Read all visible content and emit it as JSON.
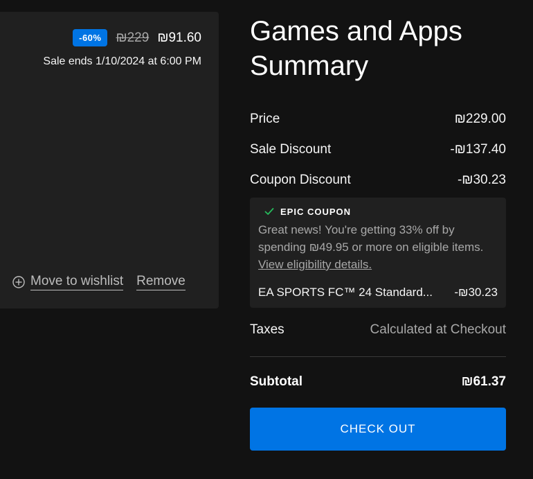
{
  "item": {
    "discount_badge": "-60%",
    "original_price": "₪229",
    "sale_price": "₪91.60",
    "sale_ends": "Sale ends 1/10/2024 at 6:00 PM",
    "move_to_wishlist": "Move to wishlist",
    "remove": "Remove"
  },
  "summary": {
    "title": "Games and Apps Summary",
    "price_label": "Price",
    "price_value": "₪229.00",
    "sale_discount_label": "Sale Discount",
    "sale_discount_value": "-₪137.40",
    "coupon_discount_label": "Coupon Discount",
    "coupon_discount_value": "-₪30.23",
    "coupon": {
      "heading": "EPIC COUPON",
      "text": "Great news! You're getting 33% off by spending ₪49.95 or more on eligible items. ",
      "link": "View eligibility details.",
      "item_name": "EA SPORTS FC™ 24 Standard...",
      "item_value": "-₪30.23"
    },
    "taxes_label": "Taxes",
    "taxes_value": "Calculated at Checkout",
    "subtotal_label": "Subtotal",
    "subtotal_value": "₪61.37",
    "checkout_label": "CHECK OUT"
  },
  "colors": {
    "background": "#121212",
    "card": "#202020",
    "accent": "#0074e4",
    "coupon_check": "#26bb5c"
  },
  "icons": {
    "wishlist": "plus-circle-icon",
    "coupon": "check-icon"
  }
}
